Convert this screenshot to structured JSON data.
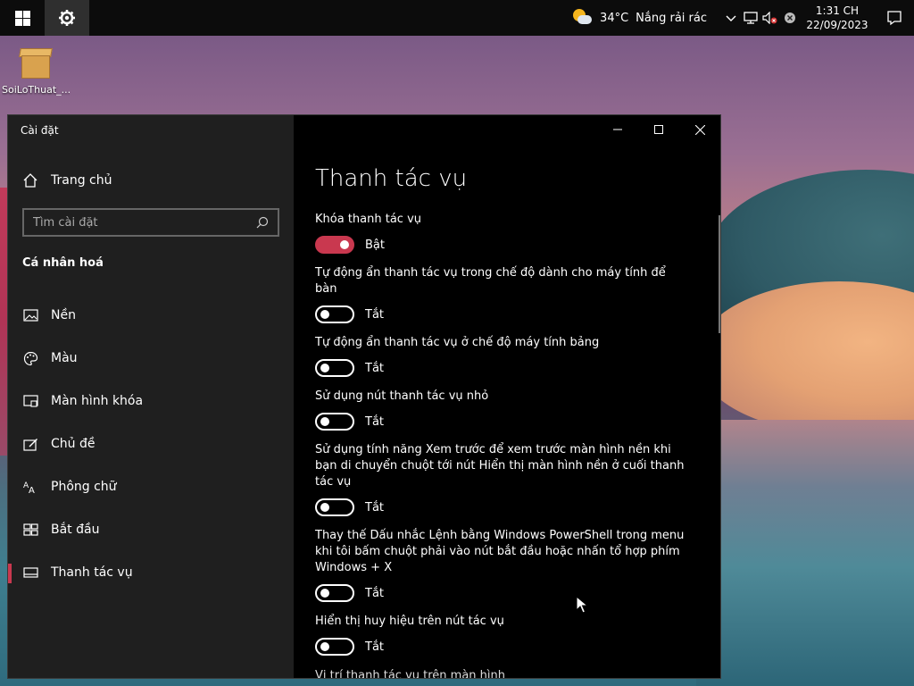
{
  "taskbar": {
    "temperature": "34°C",
    "weather_text": "Nắng rải rác",
    "time": "1:31 CH",
    "date": "22/09/2023"
  },
  "desktop": {
    "icon_label": "SoiLoThuat_..."
  },
  "window": {
    "app_title": "Cài đặt",
    "home_label": "Trang chủ",
    "search_placeholder": "Tìm cài đặt",
    "section_label": "Cá nhân hoá",
    "nav_items": [
      {
        "label": "Nền",
        "icon": "image-icon"
      },
      {
        "label": "Màu",
        "icon": "palette-icon"
      },
      {
        "label": "Màn hình khóa",
        "icon": "lock-screen-icon"
      },
      {
        "label": "Chủ đề",
        "icon": "theme-icon"
      },
      {
        "label": "Phông chữ",
        "icon": "font-icon"
      },
      {
        "label": "Bắt đầu",
        "icon": "start-icon"
      },
      {
        "label": "Thanh tác vụ",
        "icon": "taskbar-icon"
      }
    ],
    "selected_nav": "Thanh tác vụ"
  },
  "content": {
    "title": "Thanh tác vụ",
    "settings": [
      {
        "label": "Khóa thanh tác vụ",
        "state": "Bật",
        "on": true
      },
      {
        "label": "Tự động ẩn thanh tác vụ trong chế độ dành cho máy tính để bàn",
        "state": "Tắt",
        "on": false
      },
      {
        "label": "Tự động ẩn thanh tác vụ ở chế độ máy tính bảng",
        "state": "Tắt",
        "on": false
      },
      {
        "label": "Sử dụng nút thanh tác vụ nhỏ",
        "state": "Tắt",
        "on": false
      },
      {
        "label": "Sử dụng tính năng Xem trước để xem trước màn hình nền khi bạn di chuyển chuột tới nút Hiển thị màn hình nền ở cuối thanh tác vụ",
        "state": "Tắt",
        "on": false
      },
      {
        "label": "Thay thế Dấu nhắc Lệnh bằng Windows PowerShell trong menu khi tôi bấm chuột phải vào nút bắt đầu hoặc nhấn tổ hợp phím Windows + X",
        "state": "Tắt",
        "on": false
      },
      {
        "label": "Hiển thị huy hiệu trên nút tác vụ",
        "state": "Tắt",
        "on": false
      }
    ],
    "partial_label": "Vị trí thanh tác vụ trên màn hình"
  },
  "colors": {
    "accent": "#c9384f",
    "nav_bg": "#1f1f1f",
    "content_bg": "#000000"
  }
}
